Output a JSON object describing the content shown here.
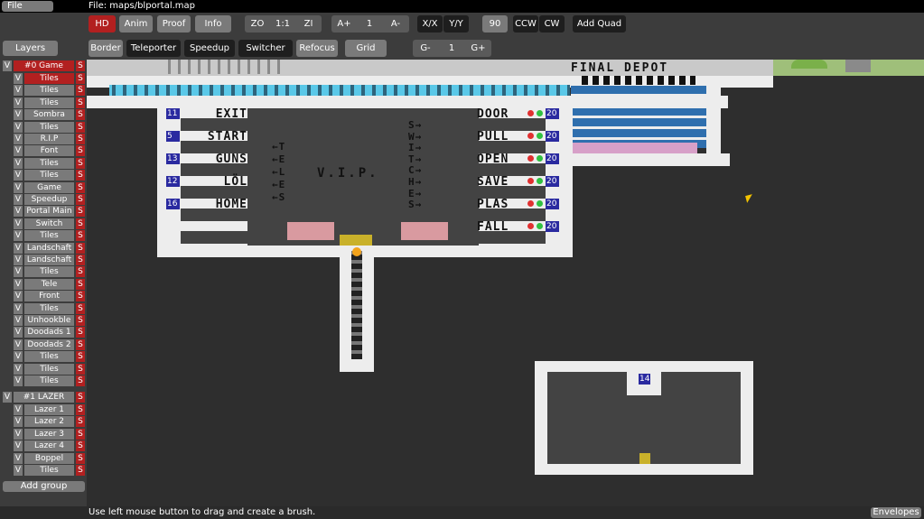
{
  "topbar": {
    "menu_label": "File",
    "file_label": "File: maps/blportal.map"
  },
  "toolbar": {
    "row1": {
      "hd": "HD",
      "anim": "Anim",
      "proof": "Proof",
      "info": "Info",
      "zoom_out": "ZO",
      "zoom_reset": "1:1",
      "zoom_in": "ZI",
      "anim_faster": "A+",
      "anim_speed": "1",
      "anim_slower": "A-",
      "flip_x": "X/X",
      "flip_y": "Y/Y",
      "rot_angle": "90",
      "rot_ccw": "CCW",
      "rot_cw": "CW",
      "add_quad": "Add Quad"
    },
    "row2": {
      "border": "Border",
      "teleporter": "Teleporter",
      "speedup": "Speedup",
      "switcher": "Switcher",
      "refocus": "Refocus",
      "grid": "Grid",
      "grid_dec": "G-",
      "grid_value": "1",
      "grid_inc": "G+"
    }
  },
  "sidebar": {
    "title": "Layers",
    "group0": {
      "visible": "V",
      "name": "#0 Game",
      "save": "S"
    },
    "group0_layers": [
      {
        "v": "V",
        "name": "Tiles",
        "s": "S"
      },
      {
        "v": "V",
        "name": "Tiles",
        "s": "S"
      },
      {
        "v": "V",
        "name": "Tiles",
        "s": "S"
      },
      {
        "v": "V",
        "name": "Sombra",
        "s": "S"
      },
      {
        "v": "V",
        "name": "Tiles",
        "s": "S"
      },
      {
        "v": "V",
        "name": "R.I.P",
        "s": "S"
      },
      {
        "v": "V",
        "name": "Font",
        "s": "S"
      },
      {
        "v": "V",
        "name": "Tiles",
        "s": "S"
      },
      {
        "v": "V",
        "name": "Tiles",
        "s": "S"
      },
      {
        "v": "V",
        "name": "Game",
        "s": "S"
      },
      {
        "v": "V",
        "name": "Speedup",
        "s": "S"
      },
      {
        "v": "V",
        "name": "Portal Main",
        "s": "S"
      },
      {
        "v": "V",
        "name": "Switch",
        "s": "S"
      },
      {
        "v": "V",
        "name": "Tiles",
        "s": "S"
      },
      {
        "v": "V",
        "name": "Landschaft",
        "s": "S"
      },
      {
        "v": "V",
        "name": "Landschaft",
        "s": "S"
      },
      {
        "v": "V",
        "name": "Tiles",
        "s": "S"
      },
      {
        "v": "V",
        "name": "Tele",
        "s": "S"
      },
      {
        "v": "V",
        "name": "Front",
        "s": "S"
      },
      {
        "v": "V",
        "name": "Tiles",
        "s": "S"
      },
      {
        "v": "V",
        "name": "Unhookble",
        "s": "S"
      },
      {
        "v": "V",
        "name": "Doodads 1",
        "s": "S"
      },
      {
        "v": "V",
        "name": "Doodads 2",
        "s": "S"
      },
      {
        "v": "V",
        "name": "Tiles",
        "s": "S"
      },
      {
        "v": "V",
        "name": "Tiles",
        "s": "S"
      },
      {
        "v": "V",
        "name": "Tiles",
        "s": "S"
      }
    ],
    "group1": {
      "visible": "V",
      "name": "#1 LAZER",
      "save": "S"
    },
    "group1_layers": [
      {
        "v": "V",
        "name": "Lazer 1",
        "s": "S"
      },
      {
        "v": "V",
        "name": "Lazer 2",
        "s": "S"
      },
      {
        "v": "V",
        "name": "Lazer 3",
        "s": "S"
      },
      {
        "v": "V",
        "name": "Lazer 4",
        "s": "S"
      },
      {
        "v": "V",
        "name": "Boppel",
        "s": "S"
      },
      {
        "v": "V",
        "name": "Tiles",
        "s": "S"
      }
    ],
    "add_group": "Add group"
  },
  "map": {
    "final_depot": "FINAL DEPOT",
    "left_labels": [
      {
        "num": "11",
        "text": "EXIT"
      },
      {
        "num": "5",
        "text": "START"
      },
      {
        "num": "13",
        "text": "GUNS"
      },
      {
        "num": "12",
        "text": "LÖL"
      },
      {
        "num": "16",
        "text": "HOME"
      }
    ],
    "right_labels": [
      {
        "text": "DOOR",
        "num": "20"
      },
      {
        "text": "PULL",
        "num": "20"
      },
      {
        "text": "OPEN",
        "num": "20"
      },
      {
        "text": "SAVE",
        "num": "20"
      },
      {
        "text": "PLAS",
        "num": "20"
      },
      {
        "text": "FALL",
        "num": "20"
      }
    ],
    "vip": "V.I.P.",
    "tele_arrows": [
      "←T",
      "←E",
      "←L",
      "←E",
      "←S"
    ],
    "switches_arrows": [
      "S→",
      "W→",
      "I→",
      "T→",
      "C→",
      "H→",
      "E→",
      "S→"
    ],
    "room_number": "14",
    "colors": {
      "wall": "#ededed",
      "bg": "#434343",
      "void": "#2e2e2e",
      "speedup": "#5ac8e8",
      "accent_red": "#b22020"
    }
  },
  "statusbar": {
    "hint": "Use left mouse button to drag and create a brush.",
    "envelopes": "Envelopes"
  }
}
